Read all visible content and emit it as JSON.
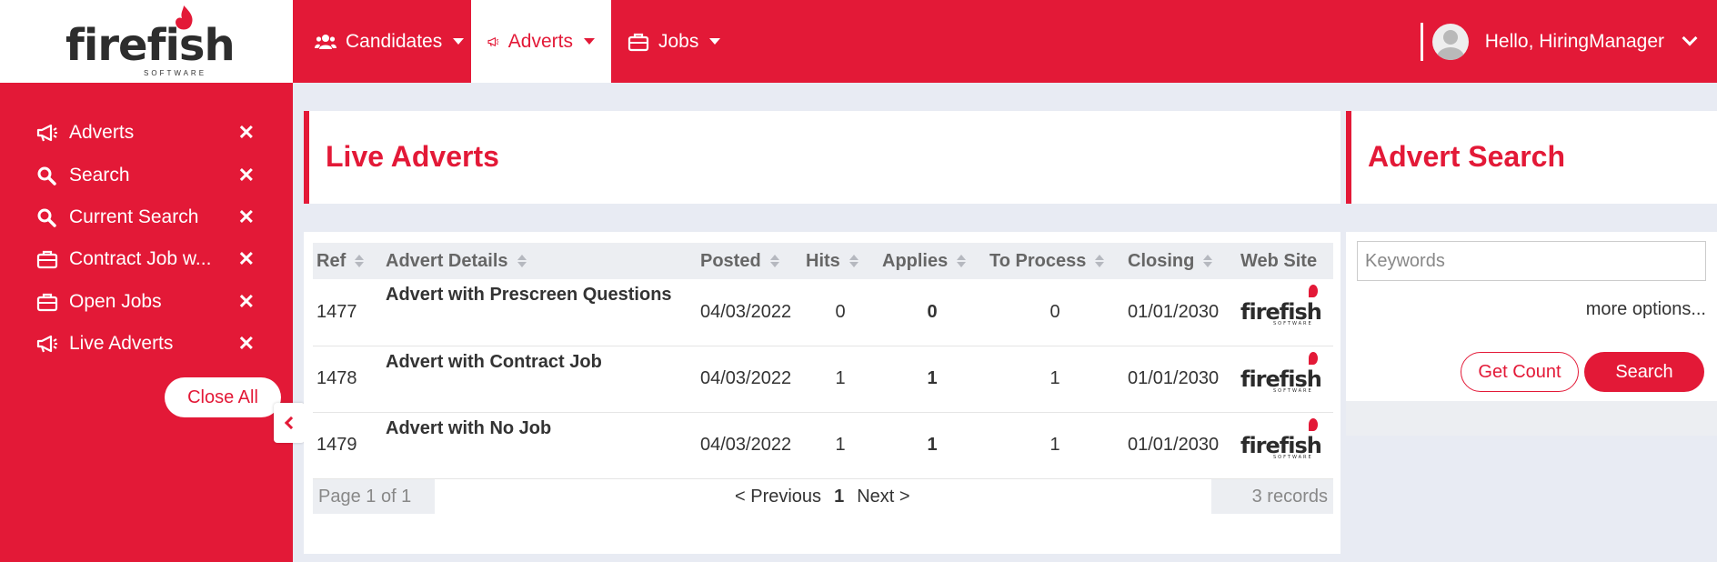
{
  "brand": {
    "name": "firefish",
    "sub": "SOFTWARE",
    "accent": "#e31937"
  },
  "topnav": [
    {
      "label": "Candidates",
      "icon": "users-icon"
    },
    {
      "label": "Adverts",
      "icon": "megaphone-icon",
      "active": true
    },
    {
      "label": "Jobs",
      "icon": "briefcase-icon"
    }
  ],
  "user": {
    "greeting": "Hello, HiringManager"
  },
  "sidebar": {
    "items": [
      {
        "label": "Adverts",
        "icon": "megaphone-icon"
      },
      {
        "label": "Search",
        "icon": "search-icon"
      },
      {
        "label": "Current Search",
        "icon": "search-icon"
      },
      {
        "label": "Contract Job w...",
        "icon": "briefcase-icon"
      },
      {
        "label": "Open Jobs",
        "icon": "briefcase-icon"
      },
      {
        "label": "Live Adverts",
        "icon": "megaphone-icon"
      }
    ],
    "close_symbol": "✕",
    "close_all": "Close All"
  },
  "main": {
    "title": "Live Adverts",
    "columns": [
      "Ref",
      "Advert Details",
      "Posted",
      "Hits",
      "Applies",
      "To Process",
      "Closing",
      "Web Site"
    ],
    "rows": [
      {
        "ref": "1477",
        "details": "Advert with Prescreen Questions",
        "posted": "04/03/2022",
        "hits": "0",
        "applies": "0",
        "to_process": "0",
        "closing": "01/01/2030"
      },
      {
        "ref": "1478",
        "details": "Advert with Contract Job",
        "posted": "04/03/2022",
        "hits": "1",
        "applies": "1",
        "to_process": "1",
        "closing": "01/01/2030"
      },
      {
        "ref": "1479",
        "details": "Advert with No Job",
        "posted": "04/03/2022",
        "hits": "1",
        "applies": "1",
        "to_process": "1",
        "closing": "01/01/2030"
      }
    ],
    "pager": {
      "page_info": "Page 1 of 1",
      "prev": "< Previous",
      "current": "1",
      "next": "Next >",
      "records": "3 records"
    }
  },
  "search": {
    "title": "Advert Search",
    "keywords_placeholder": "Keywords",
    "more_options": "more options...",
    "get_count": "Get Count",
    "search_button": "Search"
  }
}
